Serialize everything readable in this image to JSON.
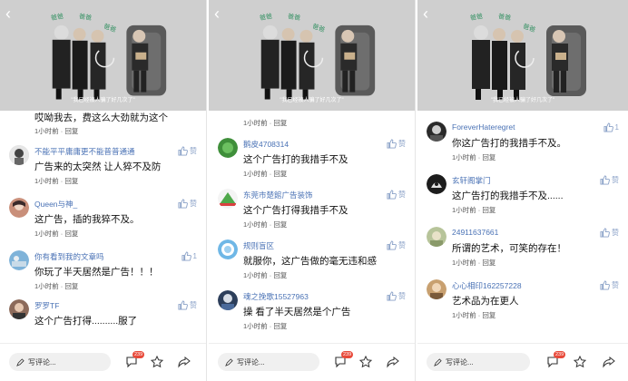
{
  "video": {
    "title_words": [
      "爸爸",
      "爸爸",
      "爸爸"
    ],
    "subtitle": "\"我已经被人骗了好几次了\""
  },
  "bottom": {
    "write_label": "写评论...",
    "badge_count": "239"
  },
  "panels": [
    {
      "top_comment_fragment": "哎呦我去，费这么大劲就为这个",
      "top_meta": "1小时前 · 回复",
      "comments": [
        {
          "user": "不能平平庸庸更不能普普通通",
          "text": "广告来的太突然 让人猝不及防",
          "meta": "1小时前 · 回复",
          "like": "赞"
        },
        {
          "user": "Queen与神_",
          "text": "这广告，插的我猝不及。",
          "meta": "1小时前 · 回复",
          "like": "赞"
        },
        {
          "user": "你有看到我的文章吗",
          "text": "你玩了半天居然是广告！！！",
          "meta": "1小时前 · 回复",
          "like": "1"
        },
        {
          "user": "罗罗TF",
          "text": "这个广告打得..........服了",
          "meta": "",
          "like": "赞"
        }
      ]
    },
    {
      "top_meta": "1小时前 · 回复",
      "comments": [
        {
          "user": "鹅皮4708314",
          "text": "这个广告打的我措手不及",
          "meta": "1小时前 · 回复",
          "like": "赞"
        },
        {
          "user": "东莞市楚館广告装饰",
          "text": "这个广告打得我措手不及",
          "meta": "1小时前 · 回复",
          "like": "赞"
        },
        {
          "user": "规则盲区",
          "text": "就服你，这广告做的毫无违和感",
          "meta": "1小时前 · 回复",
          "like": "赞"
        },
        {
          "user": "魂之挽歌15527963",
          "text": "操 看了半天居然是个广告",
          "meta": "1小时前 · 回复",
          "like": "赞"
        }
      ]
    },
    {
      "comments": [
        {
          "user": "ForeverHateregret",
          "text": "你这广告打的我措手不及。",
          "meta": "1小时前 · 回复",
          "like": "1"
        },
        {
          "user": "玄轩阁掌门",
          "text": "这广告打的我措手不及......",
          "meta": "1小时前 · 回复",
          "like": "赞"
        },
        {
          "user": "24911637661",
          "text": "所谓的艺术，可笑的存在！",
          "meta": "1小时前 · 回复",
          "like": "赞"
        },
        {
          "user": "心心相印162257228",
          "text": "艺术品为在更人",
          "meta": "1小时前 · 回复",
          "like": "赞"
        }
      ]
    }
  ],
  "colors": {
    "username": "#4a72b5",
    "like": "#8ba2c8",
    "badge": "#e84a3a",
    "video_bg": "#cfcfcf"
  }
}
